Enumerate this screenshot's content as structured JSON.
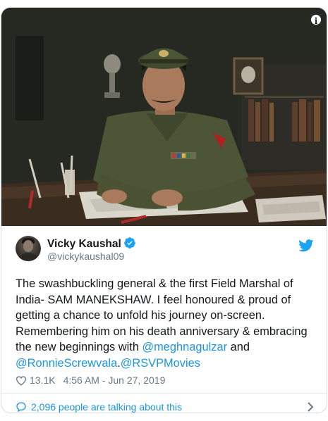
{
  "photo": {
    "info_icon": "i"
  },
  "author": {
    "name": "Vicky Kaushal",
    "handle": "@vickykaushal09",
    "verified": true
  },
  "tweet": {
    "text_1": "The swashbuckling general & the first Field Marshal of India- SAM MANEKSHAW. I feel honoured & proud of getting a chance to unfold his journey on-screen. Remembering him on his death anniversary & embracing the new beginnings with ",
    "mention_1": "@meghnagulzar",
    "text_2": " and ",
    "mention_2": "@RonnieScrewvala",
    "text_3": ".",
    "mention_3": "@RSVPMovies"
  },
  "meta": {
    "likes": "13.1K",
    "timestamp": "4:56 AM - Jun 27, 2019"
  },
  "footer": {
    "talking_text": "2,096 people are talking about this"
  },
  "colors": {
    "link": "#1b95e0",
    "secondary_text": "#657786",
    "border": "#e1e8ed",
    "twitter_blue": "#1da1f2"
  },
  "icons": {
    "info": "info-icon",
    "verified": "verified-badge-icon",
    "twitter": "twitter-bird-icon",
    "like": "heart-icon",
    "reply": "speech-bubble-icon",
    "chevron": "chevron-right-icon"
  }
}
